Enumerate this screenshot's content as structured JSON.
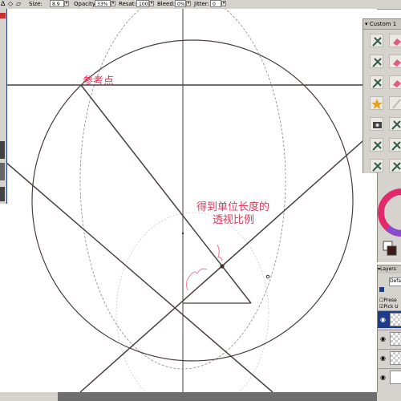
{
  "toolbar": {
    "size_label": "Size:",
    "size_value": "8.9",
    "opacity_label": "Opacity:",
    "opacity_value": "33%",
    "resat_label": "Resat:",
    "resat_value": "100",
    "bleed_label": "Bleed:",
    "bleed_value": "0%",
    "jitter_label": "Jitter:",
    "jitter_value": "0"
  },
  "annotations": {
    "reference_point": "参考点",
    "unit_length_line1": "得到单位长度的",
    "unit_length_line2": "透视比例"
  },
  "brush_panel": {
    "title": "Custom 1",
    "icons": [
      "pen-icon",
      "eraser-icon",
      "pen-icon",
      "eraser-icon",
      "pen-icon",
      "eraser-icon",
      "star-icon",
      "pencil-icon",
      "camera-icon",
      "pen-icon",
      "pen-icon",
      "pen-icon",
      "pen-icon",
      "pen-icon"
    ]
  },
  "layers_panel": {
    "title": "Layers",
    "blend_mode": "Defa",
    "preserve_label": "Prese",
    "pick_label": "Pick U"
  },
  "colors": {
    "annotation": "#e0395d",
    "lines": "#4a3f3f",
    "guide": "#8a8a8a",
    "selection": "#1e3b8a"
  }
}
